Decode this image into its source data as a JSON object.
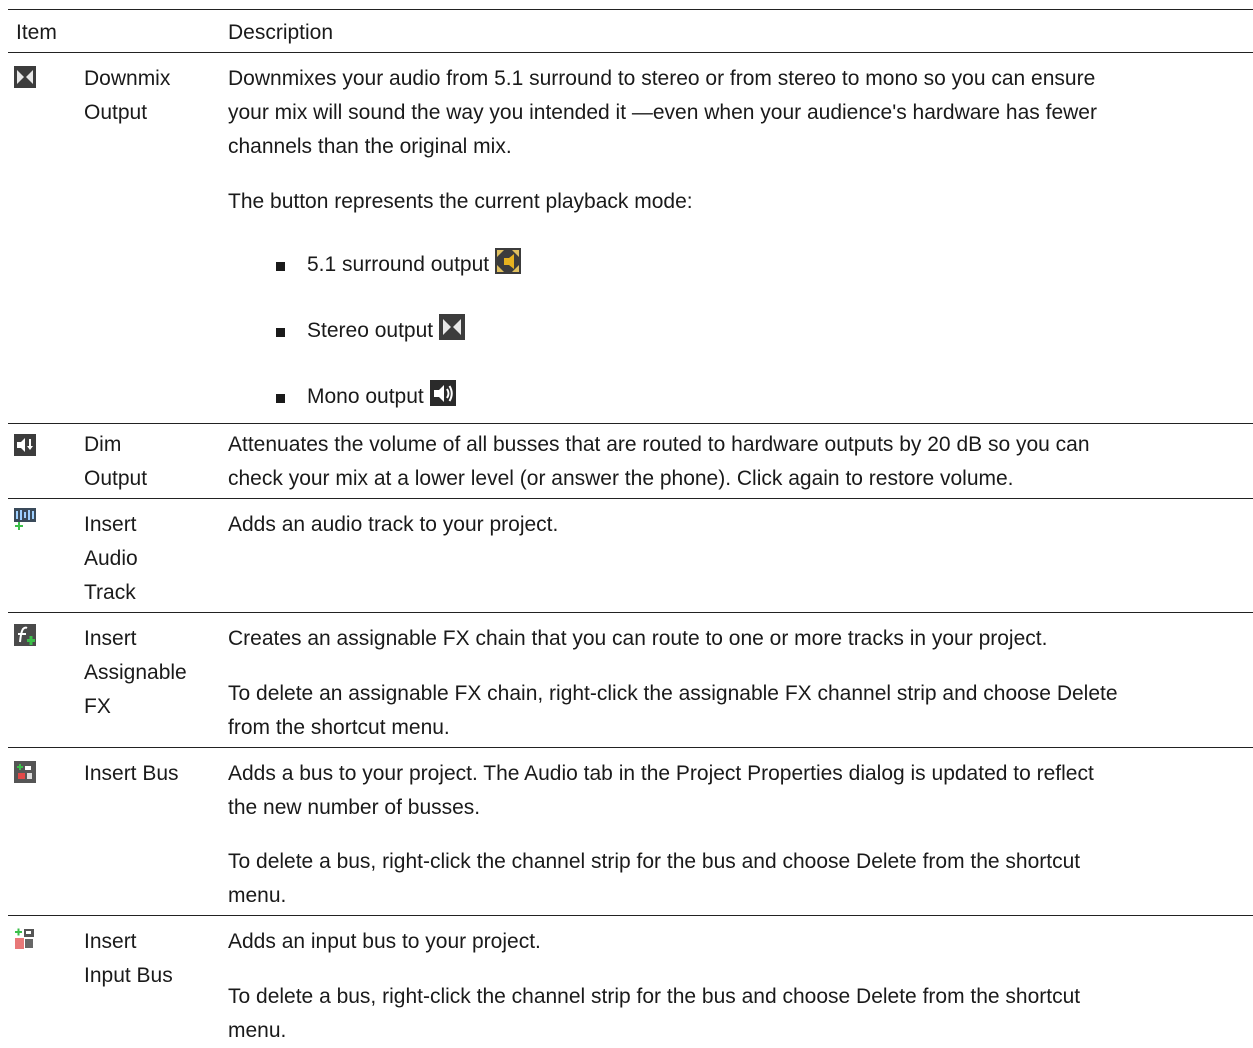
{
  "header": {
    "item": "Item",
    "description": "Description"
  },
  "rows": [
    {
      "icon": "downmix-icon",
      "item_lines": [
        "Downmix",
        "Output"
      ],
      "paragraphs": [
        [
          "Downmixes your audio from 5.1 surround to stereo or from stereo to mono so you can ensure",
          "your mix will sound the way you intended it —even when your audience's hardware has fewer",
          "channels than the original mix."
        ],
        [
          "The button represents the current playback mode:"
        ]
      ],
      "bullets": [
        {
          "text": "5.1 surround output",
          "icon": "surround-output-icon"
        },
        {
          "text": "Stereo output",
          "icon": "stereo-output-icon"
        },
        {
          "text": "Mono output",
          "icon": "mono-output-icon"
        }
      ]
    },
    {
      "icon": "dim-output-icon",
      "item_lines": [
        "Dim",
        "Output"
      ],
      "paragraphs": [
        [
          "Attenuates the volume of all busses that are routed to hardware outputs by 20 dB so you can",
          "check your mix at a lower level (or answer the phone). Click again to restore volume."
        ]
      ]
    },
    {
      "icon": "insert-audio-track-icon",
      "item_lines": [
        "Insert",
        "Audio",
        "Track"
      ],
      "paragraphs": [
        [
          "Adds an audio track to your project."
        ]
      ]
    },
    {
      "icon": "insert-assignable-fx-icon",
      "item_lines": [
        "Insert",
        "Assignable",
        "FX"
      ],
      "paragraphs": [
        [
          "Creates an assignable FX chain that you can route to one or more tracks in your project."
        ],
        [
          "To delete an assignable FX chain, right-click the assignable FX channel strip and choose Delete",
          "from the shortcut menu."
        ]
      ]
    },
    {
      "icon": "insert-bus-icon",
      "item_lines": [
        "Insert Bus"
      ],
      "paragraphs": [
        [
          "Adds a bus to your project. The Audio tab in the Project Properties dialog is updated to reflect",
          "the new number of busses."
        ],
        [
          "To delete a bus, right-click the channel strip for the bus and choose Delete from the shortcut",
          "menu."
        ]
      ]
    },
    {
      "icon": "insert-input-bus-icon",
      "item_lines": [
        "Insert",
        "Input Bus"
      ],
      "paragraphs": [
        [
          "Adds an input bus to your project."
        ],
        [
          "To delete a bus, right-click the channel strip for the bus and choose Delete from the shortcut",
          "menu."
        ]
      ]
    }
  ]
}
